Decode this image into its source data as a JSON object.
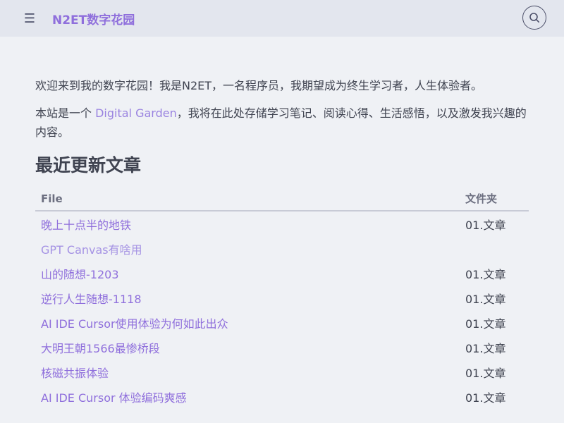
{
  "header": {
    "title": "N2ET数字花园",
    "menu_icon": "hamburger-menu-icon",
    "search_icon": "search-icon"
  },
  "intro": {
    "p1": "欢迎来到我的数字花园！我是N2ET，一名程序员，我期望成为终生学习者，人生体验者。",
    "p2_before": "本站是一个 ",
    "p2_link": "Digital Garden",
    "p2_after": "，我将在此处存储学习笔记、阅读心得、生活感悟，以及激发我兴趣的内容。"
  },
  "recent": {
    "title": "最近更新文章",
    "columns": {
      "file": "File",
      "folder": "文件夹"
    },
    "rows": [
      {
        "title": "晚上十点半的地铁",
        "folder": "01.文章"
      },
      {
        "title": "GPT Canvas有啥用",
        "folder": ""
      },
      {
        "title": "山的随想-1203",
        "folder": "01.文章"
      },
      {
        "title": "逆行人生随想-1118",
        "folder": "01.文章"
      },
      {
        "title": "AI IDE Cursor使用体验为何如此出众",
        "folder": "01.文章"
      },
      {
        "title": "大明王朝1566最惨桥段",
        "folder": "01.文章"
      },
      {
        "title": "核磁共振体验",
        "folder": "01.文章"
      },
      {
        "title": "AI IDE Cursor 体验编码爽感",
        "folder": "01.文章"
      }
    ]
  },
  "colors": {
    "accent": "#8f6fdc",
    "background": "#eff1f5",
    "header_bg": "#e3e6ee"
  }
}
